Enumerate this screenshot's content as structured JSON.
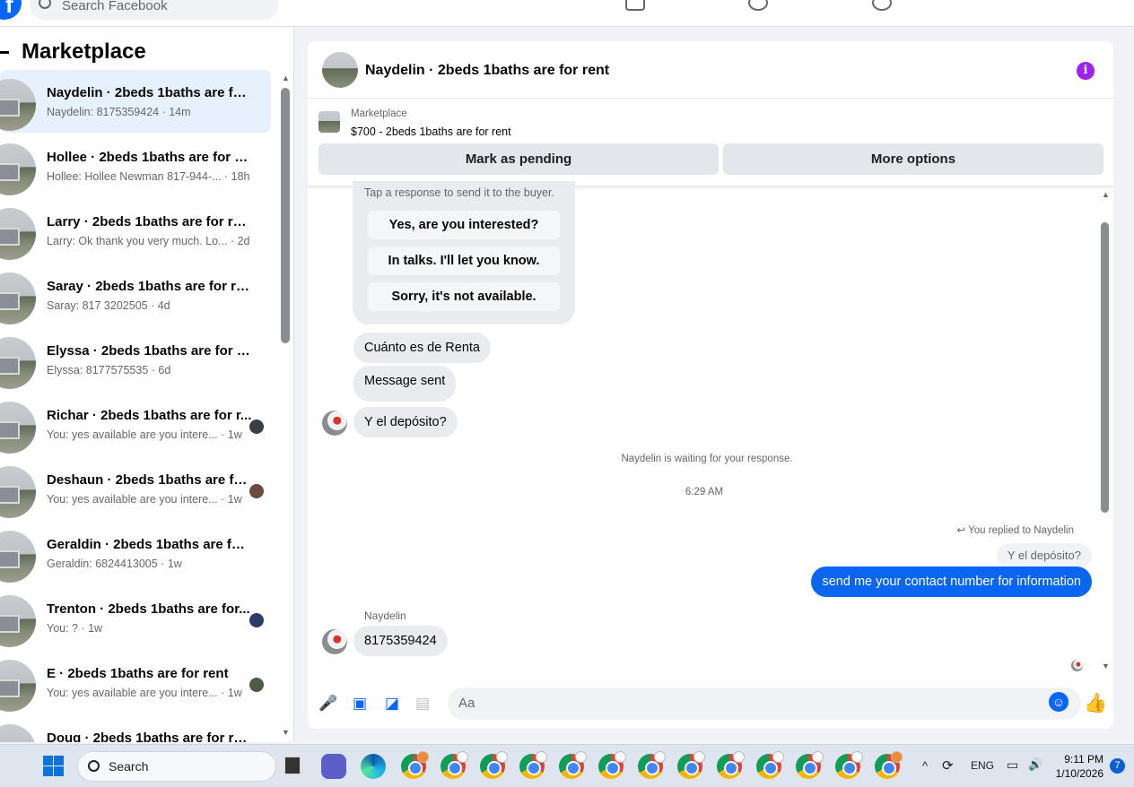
{
  "topbar": {
    "search_placeholder": "Search Facebook",
    "logo_letter": "f"
  },
  "sidebar": {
    "title": "Marketplace",
    "conversations": [
      {
        "name": "Naydelin · 2beds 1baths are for ...",
        "snippet": "Naydelin: 8175359424 · 14m",
        "active": true
      },
      {
        "name": "Hollee · 2beds 1baths are for rent",
        "snippet": "Hollee: Hollee Newman 817-944-... · 18h"
      },
      {
        "name": "Larry · 2beds 1baths are for rent",
        "snippet": "Larry: Ok thank you very much. Lo... · 2d"
      },
      {
        "name": "Saray · 2beds 1baths are for rent",
        "snippet": "Saray: 817 3202505 · 4d"
      },
      {
        "name": "Elyssa · 2beds 1baths are for rent",
        "snippet": "Elyssa: 8177575535 · 6d"
      },
      {
        "name": "Richar · 2beds 1baths are for r...",
        "snippet": "You: yes available are you intere... · 1w"
      },
      {
        "name": "Deshaun · 2beds 1baths are fo...",
        "snippet": "You: yes available are you intere... · 1w"
      },
      {
        "name": "Geraldin · 2beds 1baths are for r...",
        "snippet": "Geraldin: 6824413005 · 1w"
      },
      {
        "name": "Trenton · 2beds 1baths are for...",
        "snippet": "You: ? · 1w"
      },
      {
        "name": "E · 2beds 1baths are for rent",
        "snippet": "You: yes available are you intere... · 1w"
      },
      {
        "name": "Doug · 2beds 1baths are for rent",
        "snippet": ""
      }
    ]
  },
  "chat": {
    "title": "Naydelin · 2beds 1baths are for rent",
    "info_glyph": "i",
    "listing": {
      "category": "Marketplace",
      "price_line": "$700 - 2beds 1baths are for rent"
    },
    "buttons": {
      "pending": "Mark as pending",
      "more": "More options"
    },
    "suggest_hint": "Tap a response to send it to the buyer.",
    "quick_replies": [
      "Yes, are you interested?",
      "In talks. I'll let you know.",
      "Sorry, it's not available."
    ],
    "msg1": "Cuánto es de Renta",
    "msg2": "Message sent",
    "msg3": "Y el depósito?",
    "waiting": "Naydelin is waiting for your response.",
    "time": "6:29 AM",
    "replied_to": "You replied to Naydelin",
    "quoted": "Y el depósito?",
    "my_msg": "send me your contact number for information",
    "sender": "Naydelin",
    "msg4": "8175359424",
    "composer_placeholder": "Aa"
  },
  "taskbar": {
    "search_label": "Search",
    "language": "ENG",
    "time": "9:11 PM",
    "date": "1/10/2026",
    "notification_count": "7"
  }
}
